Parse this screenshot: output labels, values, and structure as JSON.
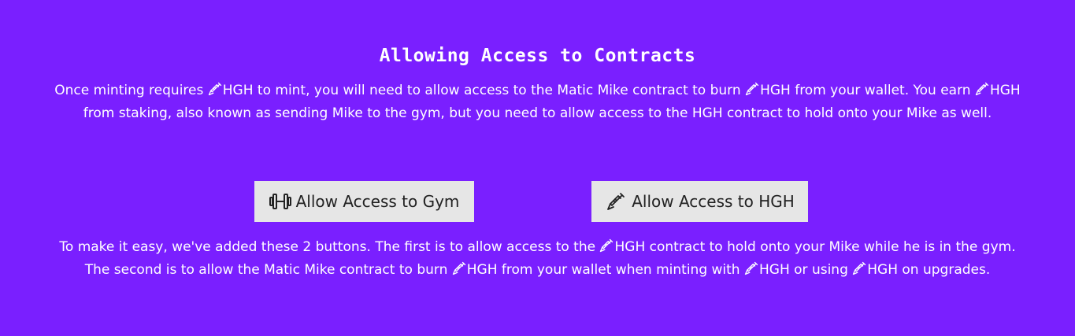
{
  "colors": {
    "background": "#7a1fff",
    "text": "#ffffff",
    "button_bg": "#e6e6e6",
    "button_text": "#222222"
  },
  "section": {
    "title": "Allowing Access to Contracts",
    "intro": {
      "line1": {
        "p1": "Once minting requires ",
        "p2": "HGH to mint, you will need to allow access to the Matic Mike contract to burn ",
        "p3": "HGH from your wallet. You earn ",
        "p4": "HGH"
      },
      "line2": "from staking, also known as sending Mike to the gym, but you need to allow access to the HGH contract to hold onto your Mike as well."
    },
    "buttons": {
      "gym": {
        "label": "Allow Access to Gym",
        "icon": "dumbbell-icon"
      },
      "hgh": {
        "label": "Allow Access to HGH",
        "icon": "syringe-icon"
      }
    },
    "outro": {
      "line1": {
        "p1": "To make it easy, we've added these 2 buttons. The first is to allow access to the ",
        "p2": "HGH contract to hold onto your Mike while he is in the gym."
      },
      "line2": {
        "p1": "The second is to allow the Matic Mike contract to burn ",
        "p2": "HGH from your wallet when minting with ",
        "p3": "HGH or using ",
        "p4": "HGH on upgrades."
      }
    },
    "inline_icon": "syringe-icon"
  }
}
